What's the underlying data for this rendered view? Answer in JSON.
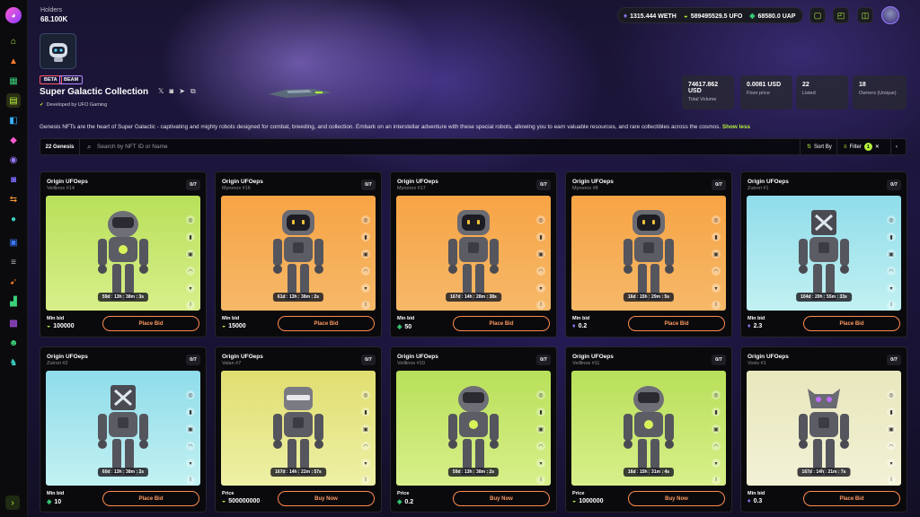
{
  "header": {
    "holders_label": "Holders",
    "holders_value": "68.100K",
    "wallet": {
      "weth": "1315.444 WETH",
      "ufo": "589495529.5 UFO",
      "uap": "68580.0 UAP"
    }
  },
  "collection": {
    "badges": [
      "BETA",
      "BEAM"
    ],
    "title": "Super Galactic Collection",
    "developer": "Developed by UFO Gaming",
    "description": "Genesis NFTs are the heart of Super Galactic - captivating and mighty robots designed for combat, breeding, and collection. Embark on an interstellar adventure with these special robots, allowing you to earn valuable resources, and rare collectibles across the cosmos.",
    "show_less": "Show less",
    "stats": [
      {
        "value": "74617.862 USD",
        "label": "Total Volume"
      },
      {
        "value": "0.0081 USD",
        "label": "Floor price"
      },
      {
        "value": "22",
        "label": "Listed"
      },
      {
        "value": "18",
        "label": "Owners (Unique)"
      }
    ]
  },
  "toolbar": {
    "count_tab": "22 Genesis",
    "search_placeholder": "Search by NFT ID or Name",
    "sort_label": "Sort By",
    "filter_label": "Filter",
    "filter_count": "1"
  },
  "cards": [
    {
      "name": "Origin UFOeps",
      "sub": "Veillinos #14",
      "count": "0/7",
      "timer": "59d : 13h : 38m : 3s",
      "price_label": "Min bid",
      "price": "100000",
      "currency": "ufo",
      "action": "Place Bid",
      "bg": "green",
      "robot": "round"
    },
    {
      "name": "Origin UFOeps",
      "sub": "Myronox #16",
      "count": "0/7",
      "timer": "61d : 13h : 38m : 2s",
      "price_label": "Min bid",
      "price": "15000",
      "currency": "ufo",
      "action": "Place Bid",
      "bg": "orange",
      "robot": "screen"
    },
    {
      "name": "Origin UFOeps",
      "sub": "Myronox #17",
      "count": "0/7",
      "timer": "167d : 14h : 28m : 38s",
      "price_label": "Min bid",
      "price": "50",
      "currency": "gem",
      "action": "Place Bid",
      "bg": "orange",
      "robot": "screen"
    },
    {
      "name": "Origin UFOeps",
      "sub": "Myronox #8",
      "count": "0/7",
      "timer": "16d : 15h : 29m : 5s",
      "price_label": "Min bid",
      "price": "0.2",
      "currency": "eth",
      "action": "Place Bid",
      "bg": "orange",
      "robot": "screen"
    },
    {
      "name": "Origin UFOeps",
      "sub": "Zutrori #1",
      "count": "0/7",
      "timer": "104d : 20h : 55m : 33s",
      "price_label": "Min bid",
      "price": "2.3",
      "currency": "eth",
      "action": "Place Bid",
      "bg": "cyan",
      "robot": "x"
    },
    {
      "name": "Origin UFOeps",
      "sub": "Zutrori #2",
      "count": "0/7",
      "timer": "60d : 13h : 38m : 2s",
      "price_label": "Min bid",
      "price": "10",
      "currency": "gem",
      "action": "Place Bid",
      "bg": "cyan",
      "robot": "x"
    },
    {
      "name": "Origin UFOeps",
      "sub": "Valan #7",
      "count": "0/7",
      "timer": "167d : 14h : 22m : 57s",
      "price_label": "Price",
      "price": "500000000",
      "currency": "ufo",
      "action": "Buy Now",
      "bg": "yellow",
      "robot": "visor"
    },
    {
      "name": "Origin UFOeps",
      "sub": "Veillinos #10",
      "count": "0/7",
      "timer": "59d : 13h : 38m : 2s",
      "price_label": "Price",
      "price": "0.2",
      "currency": "gem",
      "action": "Buy Now",
      "bg": "green",
      "robot": "round"
    },
    {
      "name": "Origin UFOeps",
      "sub": "Veillinos #11",
      "count": "0/7",
      "timer": "16d : 15h : 31m : 4s",
      "price_label": "Price",
      "price": "1000000",
      "currency": "ufo",
      "action": "Buy Now",
      "bg": "green",
      "robot": "round"
    },
    {
      "name": "Origin UFOeps",
      "sub": "Voxis #1",
      "count": "0/7",
      "timer": "167d : 14h : 21m : 7s",
      "price_label": "Min bid",
      "price": "0.3",
      "currency": "eth",
      "action": "Place Bid",
      "bg": "cream",
      "robot": "horns"
    }
  ],
  "colors": {
    "accent": "#b6f23c",
    "bid_button": "#ff8a4d",
    "bg_green": "#c6e66a",
    "bg_orange": "#f4a04a",
    "bg_cyan": "#9fe3ea",
    "bg_yellow": "#e6e67a",
    "bg_cream": "#ecebc4"
  }
}
